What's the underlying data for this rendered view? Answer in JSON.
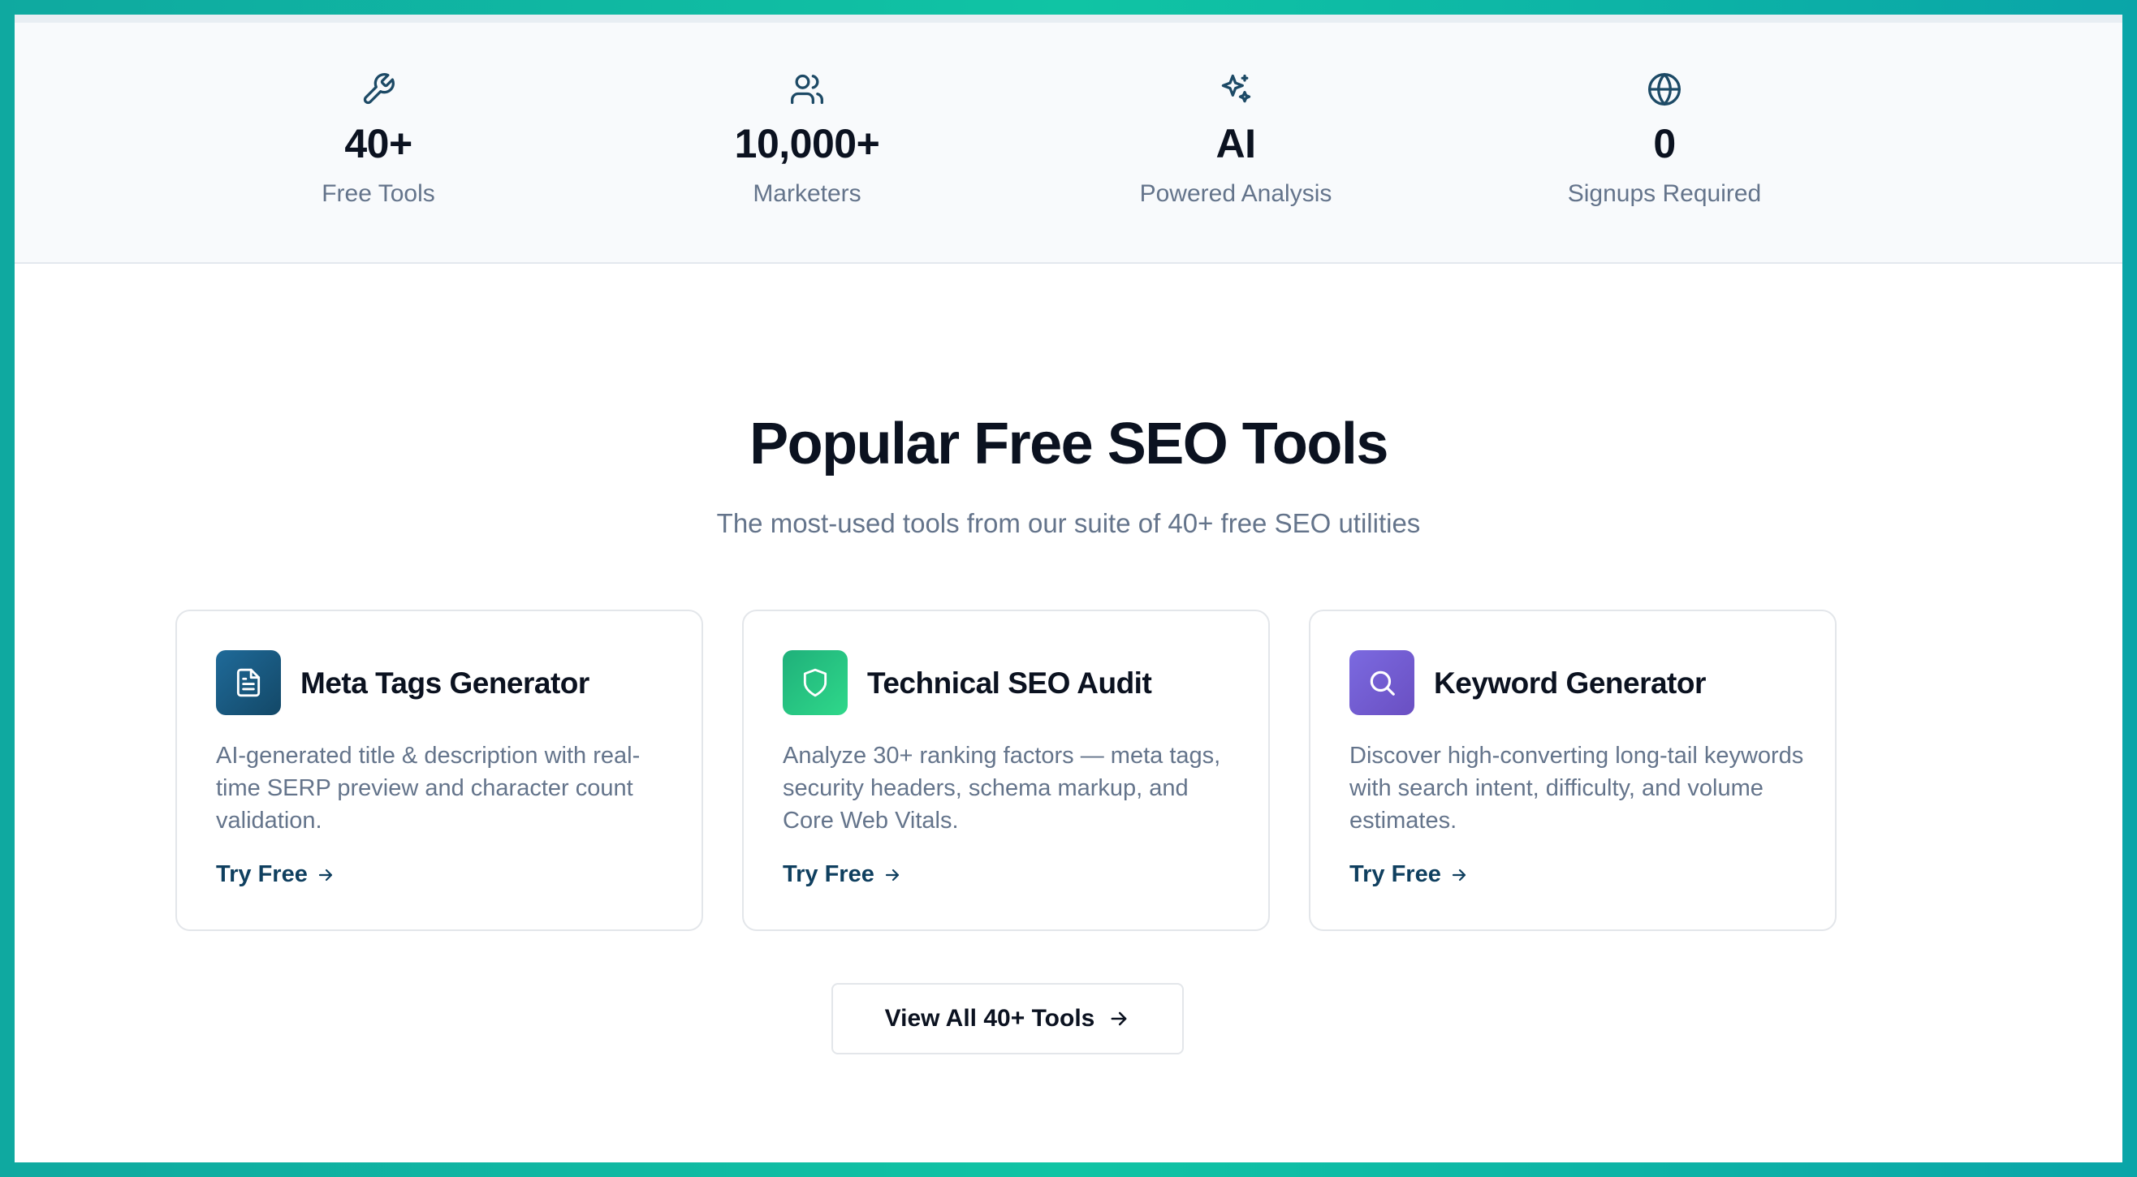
{
  "stats": [
    {
      "icon": "wrench-icon",
      "value": "40+",
      "label": "Free Tools"
    },
    {
      "icon": "users-icon",
      "value": "10,000+",
      "label": "Marketers"
    },
    {
      "icon": "sparkles-icon",
      "value": "AI",
      "label": "Powered Analysis"
    },
    {
      "icon": "globe-icon",
      "value": "0",
      "label": "Signups Required"
    }
  ],
  "section": {
    "title": "Popular Free SEO Tools",
    "subtitle": "The most-used tools from our suite of 40+ free SEO utilities"
  },
  "cards": [
    {
      "icon": "document-icon",
      "title": "Meta Tags Generator",
      "description": "AI-generated title & description with real-time SERP preview and character count validation.",
      "cta": "Try Free",
      "color": "#1a5b86"
    },
    {
      "icon": "shield-icon",
      "title": "Technical SEO Audit",
      "description": "Analyze 30+ ranking factors — meta tags, security headers, schema markup, and Core Web Vitals.",
      "cta": "Try Free",
      "color": "#22c37e"
    },
    {
      "icon": "search-icon",
      "title": "Keyword Generator",
      "description": "Discover high-converting long-tail keywords with search intent, difficulty, and volume estimates.",
      "cta": "Try Free",
      "color": "#7360d4"
    }
  ],
  "view_all": {
    "label": "View All 40+ Tools",
    "icon": "arrow-right-icon"
  },
  "colors": {
    "accent": "#0f3f5f",
    "frame": "#10c4a4",
    "text": "#0b1220",
    "muted": "#64748b"
  }
}
